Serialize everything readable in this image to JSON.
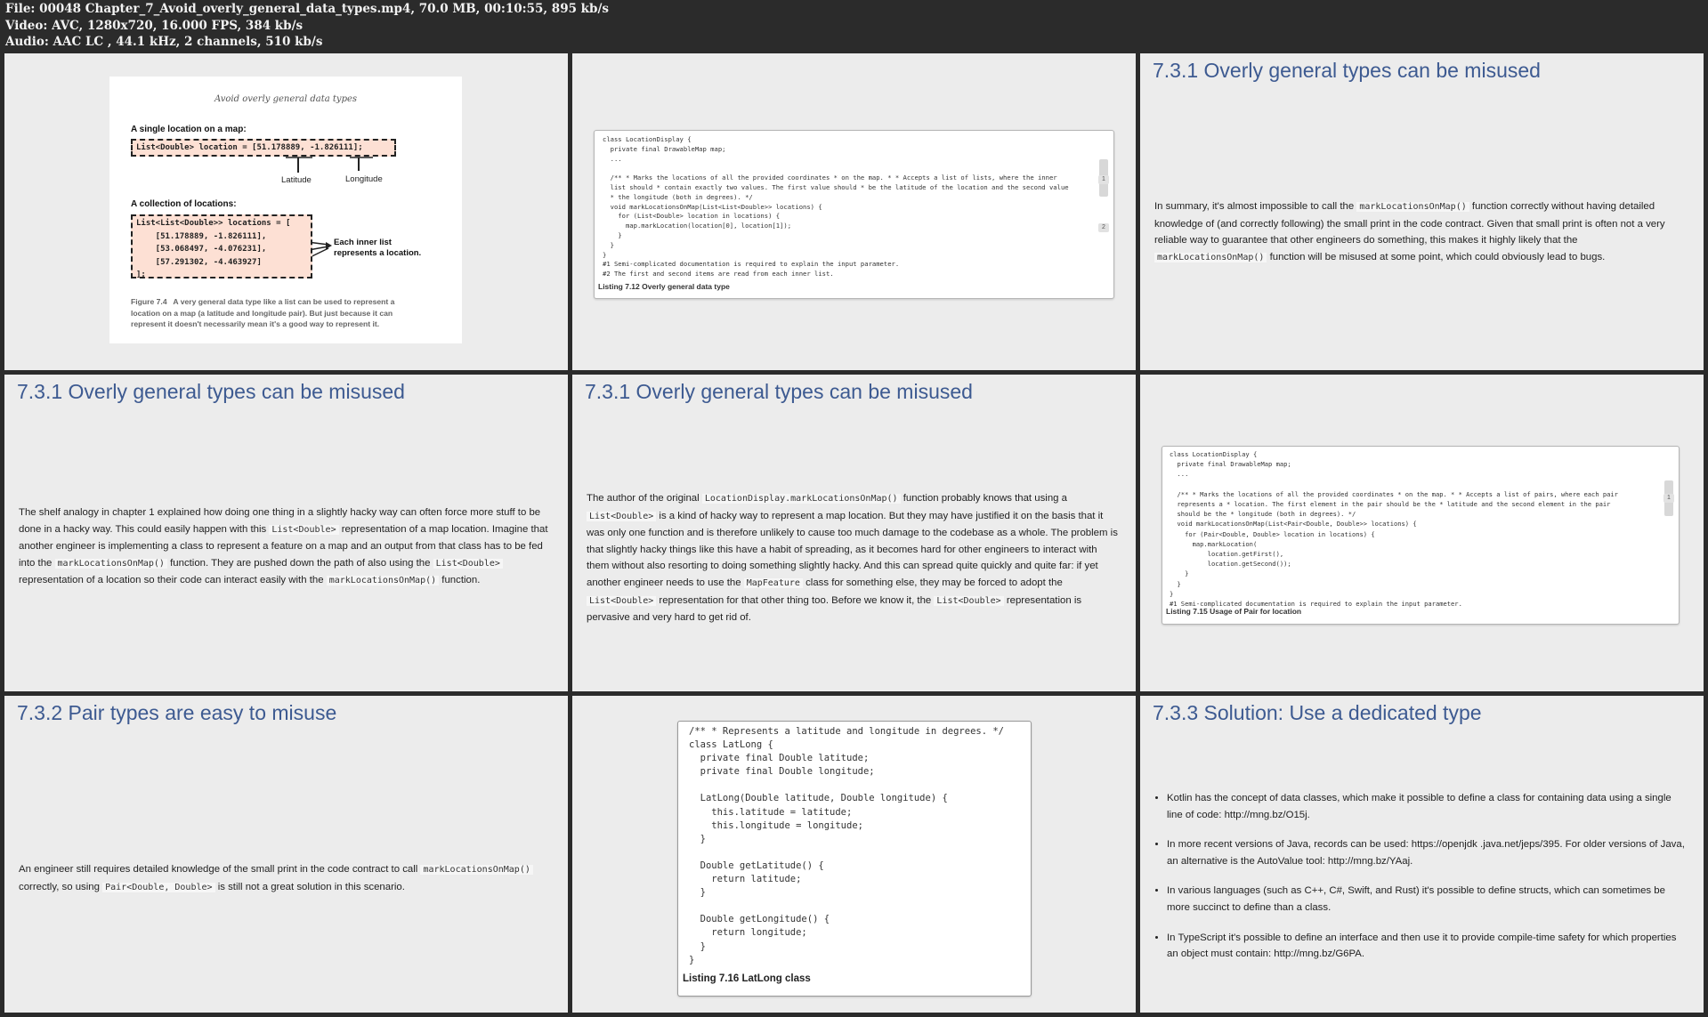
{
  "header": {
    "file_line": "File: 00048 Chapter_7_Avoid_overly_general_data_types.mp4, 70.0 MB, 00:10:55, 895 kb/s",
    "video_line": "Video: AVC, 1280x720, 16.000 FPS, 384 kb/s",
    "audio_line": "Audio: AAC LC , 44.1 kHz, 2 channels, 510 kb/s"
  },
  "cell1": {
    "figure_title": "Avoid overly general data types",
    "single_label": "A single location on a map:",
    "single_code": "List<Double> location = [51.178889, -1.826111];",
    "latitude": "Latitude",
    "longitude": "Longitude",
    "collection_label": "A collection of locations:",
    "collection_code": "List<List<Double>> locations = [\n    [51.178889, -1.826111],\n    [53.068497, -4.076231],\n    [57.291302, -4.463927]\n];",
    "annotation": "Each inner list\nrepresents a location.",
    "caption": "Figure 7.4   A very general data type like a list can be used to represent a\nlocation on a map (a latitude and longitude pair). But just because it can\nrepresent it doesn't necessarily mean it's a good way to represent it."
  },
  "cell2": {
    "code": "class LocationDisplay {\n  private final DrawableMap map;\n  ...\n\n  /** * Marks the locations of all the provided coordinates * on the map. * * Accepts a list of lists, where the inner\n  list should * contain exactly two values. The first value should * be the latitude of the location and the second value\n  * the longitude (both in degrees). */\n  void markLocationsOnMap(List<List<Double>> locations) {\n    for (List<Double> location in locations) {\n      map.markLocation(location[0], location[1]);\n    }\n  }\n}\n#1 Semi-complicated documentation is required to explain the input parameter.\n#2 The first and second items are read from each inner list.",
    "caption": "Listing 7.12 Overly general data type",
    "marker1": "1",
    "marker2": "2"
  },
  "cell3": {
    "title": "7.3.1 Overly general types can be misused",
    "p1": "In summary, it's almost impossible to call the ",
    "c1": "markLocationsOnMap()",
    "p2": " function correctly without having detailed knowledge of (and correctly following) the small print in the code contract. Given that small print is often not a very reliable way to guarantee that other engineers do something, this makes it highly likely that the ",
    "c2": "markLocationsOnMap()",
    "p3": " function will be misused at some point, which could obviously lead to bugs."
  },
  "cell4": {
    "title": "7.3.1 Overly general types can be misused",
    "p1": "The shelf analogy in chapter 1 explained how doing one thing in a slightly hacky way can often force more stuff to be done in a hacky way. This could easily happen with this ",
    "c1": "List<Double>",
    "p2": " representation of a map location. Imagine that another engineer is implementing a class to represent a feature on a map and an output from that class has to be fed into the ",
    "c2": "markLocationsOnMap()",
    "p3": " function. They are pushed down the path of also using the ",
    "c3": "List<Double>",
    "p4": " representation of a location so their code can interact easily with the ",
    "c4": "markLocationsOnMap()",
    "p5": " function."
  },
  "cell5": {
    "title": "7.3.1 Overly general types can be misused",
    "p1": "The author of the original ",
    "c1": "LocationDisplay.markLocationsOnMap()",
    "p2": " function probably knows that using a ",
    "c2": "List<Double>",
    "p3": " is a kind of hacky way to represent a map location. But they may have justified it on the basis that it was only one function and is therefore unlikely to cause too much damage to the codebase as a whole. The problem is that slightly hacky things like this have a habit of spreading, as it becomes hard for other engineers to interact with them without also resorting to doing something slightly hacky. And this can spread quite quickly and quite far: if yet another engineer needs to use the ",
    "c3": "MapFeature",
    "p4": " class for something else, they may be forced to adopt the ",
    "c4": "List<Double>",
    "p5": " representation for that other thing too. Before we know it, the ",
    "c5": "List<Double>",
    "p6": " representation is pervasive and very hard to get rid of."
  },
  "cell6": {
    "code": "class LocationDisplay {\n  private final DrawableMap map;\n  ...\n\n  /** * Marks the locations of all the provided coordinates * on the map. * * Accepts a list of pairs, where each pair\n  represents a * location. The first element in the pair should be the * latitude and the second element in the pair\n  should be the * longitude (both in degrees). */\n  void markLocationsOnMap(List<Pair<Double, Double>> locations) {\n    for (Pair<Double, Double> location in locations) {\n      map.markLocation(\n          location.getFirst(),\n          location.getSecond());\n    }\n  }\n}\n#1 Semi-complicated documentation is required to explain the input parameter.",
    "caption": "Listing 7.15 Usage of Pair for location",
    "marker1": "1"
  },
  "cell7": {
    "title": "7.3.2 Pair types are easy to misuse",
    "p1": "An engineer still requires detailed knowledge of the small print in the code contract to call ",
    "c1": "markLocationsOnMap()",
    "p2": " correctly, so using ",
    "c2": "Pair<Double, Double>",
    "p3": " is still not a great solution in this scenario."
  },
  "cell8": {
    "code": "/** * Represents a latitude and longitude in degrees. */\nclass LatLong {\n  private final Double latitude;\n  private final Double longitude;\n\n  LatLong(Double latitude, Double longitude) {\n    this.latitude = latitude;\n    this.longitude = longitude;\n  }\n\n  Double getLatitude() {\n    return latitude;\n  }\n\n  Double getLongitude() {\n    return longitude;\n  }\n}",
    "caption": "Listing 7.16 LatLong class"
  },
  "cell9": {
    "title": "7.3.3 Solution: Use a dedicated type",
    "bullets": [
      "Kotlin has the concept of data classes, which make it possible to define a class for containing data using a single line of code: http://mng.bz/O15j.",
      "In more recent versions of Java, records can be used: https://openjdk .java.net/jeps/395. For older versions of Java, an alternative is the AutoValue tool: http://mng.bz/YAaj.",
      "In various languages (such as C++, C#, Swift, and Rust) it's possible to define structs, which can sometimes be more succinct to define than a class.",
      "In TypeScript it's possible to define an interface and then use it to provide compile-time safety for which properties an object must contain: http://mng.bz/G6PA."
    ]
  }
}
